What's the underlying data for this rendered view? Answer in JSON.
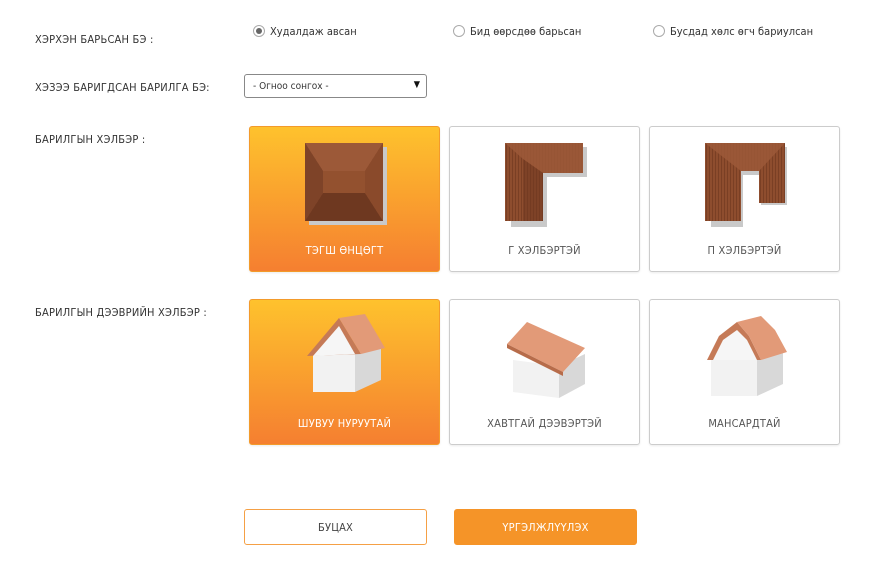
{
  "form": {
    "ownership": {
      "label": "ХЭРХЭН БАРЬСАН БЭ :",
      "options": [
        {
          "label": "Худалдаж авсан",
          "selected": true
        },
        {
          "label": "Бид өөрсдөө барьсан",
          "selected": false
        },
        {
          "label": "Бусдад хөлс өгч бариулсан",
          "selected": false
        }
      ]
    },
    "built_year": {
      "label": "ХЭЗЭЭ БАРИГДСАН БАРИЛГА БЭ:",
      "value": "- Огноо сонгох -"
    },
    "building_shape": {
      "label": "БАРИЛГЫН ХЭЛБЭР :",
      "options": [
        {
          "label": "ТЭГШ ӨНЦӨГТ",
          "icon": "rectangle-plan-icon",
          "selected": true
        },
        {
          "label": "Г ХЭЛБЭРТЭЙ",
          "icon": "l-shaped-plan-icon",
          "selected": false
        },
        {
          "label": "П ХЭЛБЭРТЭЙ",
          "icon": "u-shaped-plan-icon",
          "selected": false
        }
      ]
    },
    "roof_shape": {
      "label": "БАРИЛГЫН ДЭЭВРИЙН ХЭЛБЭР :",
      "options": [
        {
          "label": "ШУВУУ НУРУУТАЙ",
          "icon": "gable-roof-icon",
          "selected": true
        },
        {
          "label": "ХАВТГАЙ ДЭЭВЭРТЭЙ",
          "icon": "flat-roof-icon",
          "selected": false
        },
        {
          "label": "МАНСАРДТАЙ",
          "icon": "mansard-roof-icon",
          "selected": false
        }
      ]
    }
  },
  "buttons": {
    "back": "БУЦАХ",
    "next": "ҮРГЭЛЖЛҮҮЛЭХ"
  },
  "colors": {
    "accent": "#f59428",
    "selected_gradient_top": "#fec22d",
    "selected_gradient_bottom": "#f57f30",
    "roof_wood": "#8b4a2c",
    "roof_tile": "#d98f6d"
  }
}
